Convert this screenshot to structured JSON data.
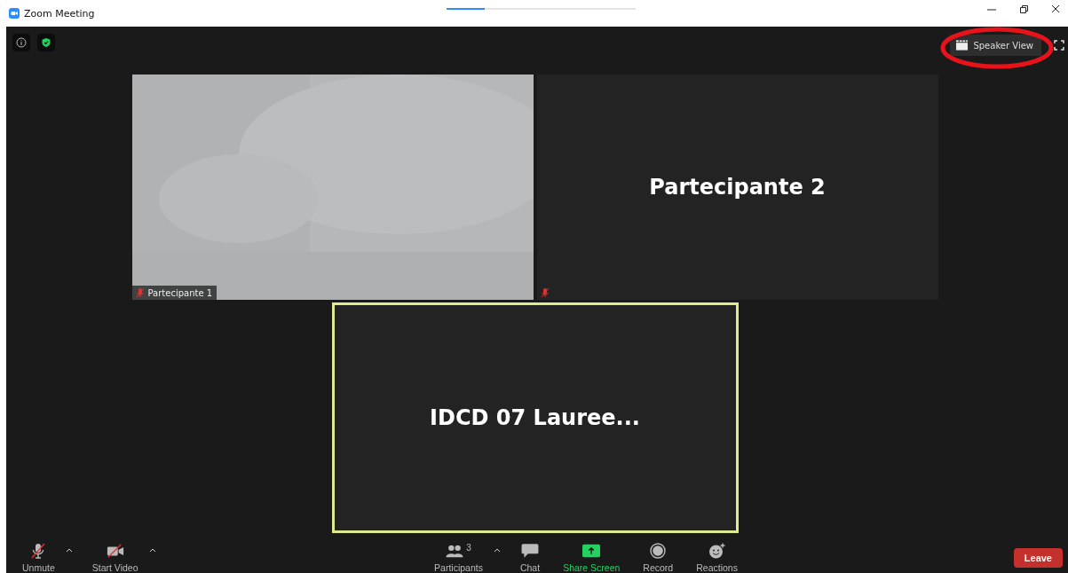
{
  "window": {
    "title": "Zoom Meeting"
  },
  "view_button": {
    "label": "Speaker View",
    "highlighted": true
  },
  "tiles": [
    {
      "kind": "video",
      "name": "Partecipante 1",
      "muted": true,
      "active": false
    },
    {
      "kind": "avatar",
      "name": "Partecipante 2",
      "muted": true,
      "active": false
    },
    {
      "kind": "avatar",
      "name": "IDCD 07 Lauree...",
      "muted": false,
      "active": true
    }
  ],
  "toolbar": [
    {
      "kind": "mic",
      "label": "Unmute",
      "caret": true,
      "off": true
    },
    {
      "kind": "video",
      "label": "Start Video",
      "caret": true,
      "off": true
    },
    {
      "kind": "participants",
      "label": "Participants",
      "count": "3",
      "caret": true
    },
    {
      "kind": "chat",
      "label": "Chat",
      "caret": false
    },
    {
      "kind": "share",
      "label": "Share Screen",
      "caret": false
    },
    {
      "kind": "record",
      "label": "Record",
      "caret": false
    },
    {
      "kind": "reactions",
      "label": "Reactions",
      "caret": false
    }
  ],
  "leave_button": {
    "label": "Leave"
  }
}
